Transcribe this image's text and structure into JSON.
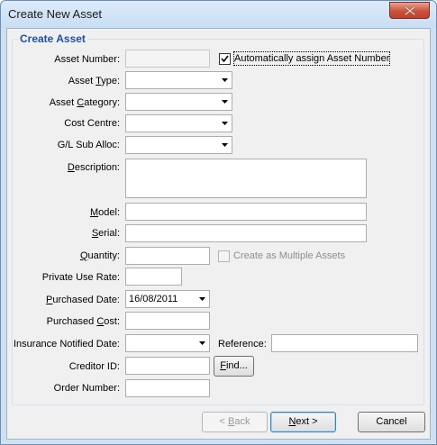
{
  "window": {
    "title": "Create New Asset"
  },
  "group": {
    "title": "Create Asset"
  },
  "fields": {
    "asset_number": {
      "label": "Asset Number:",
      "value": ""
    },
    "auto_assign": {
      "label": "Automatically assign Asset Number",
      "checked": true
    },
    "asset_type": {
      "label_pre": "Asset ",
      "label_key": "T",
      "label_post": "ype:",
      "value": ""
    },
    "asset_category": {
      "label_pre": "Asset ",
      "label_key": "C",
      "label_post": "ategory:",
      "value": ""
    },
    "cost_centre": {
      "label": "Cost Centre:",
      "value": ""
    },
    "gl_sub_alloc": {
      "label": "G/L Sub Alloc:",
      "value": ""
    },
    "description": {
      "label_key": "D",
      "label_post": "escription:",
      "value": ""
    },
    "model": {
      "label_key": "M",
      "label_post": "odel:",
      "value": ""
    },
    "serial": {
      "label_key": "S",
      "label_post": "erial:",
      "value": ""
    },
    "quantity": {
      "label_key": "Q",
      "label_post": "uantity:",
      "value": ""
    },
    "multiple_assets": {
      "label": "Create as Multiple Assets",
      "checked": false
    },
    "private_use_rate": {
      "label": "Private Use Rate:",
      "value": ""
    },
    "purchased_date": {
      "label_key": "P",
      "label_post": "urchased Date:",
      "value": "16/08/2011"
    },
    "purchased_cost": {
      "label_pre": "Purchased ",
      "label_key": "C",
      "label_post": "ost:",
      "value": ""
    },
    "insurance_notified_date": {
      "label": "Insurance Notified Date:",
      "value": ""
    },
    "reference": {
      "label": "Reference:",
      "value": ""
    },
    "creditor_id": {
      "label": "Creditor ID:",
      "value": ""
    },
    "find": {
      "label_key": "F",
      "label_post": "ind..."
    },
    "order_number": {
      "label": "Order Number:",
      "value": ""
    }
  },
  "buttons": {
    "back": {
      "label_pre": "< ",
      "label_key": "B",
      "label_post": "ack"
    },
    "next": {
      "label_key": "N",
      "label_post": "ext >"
    },
    "cancel": {
      "label": "Cancel"
    }
  }
}
